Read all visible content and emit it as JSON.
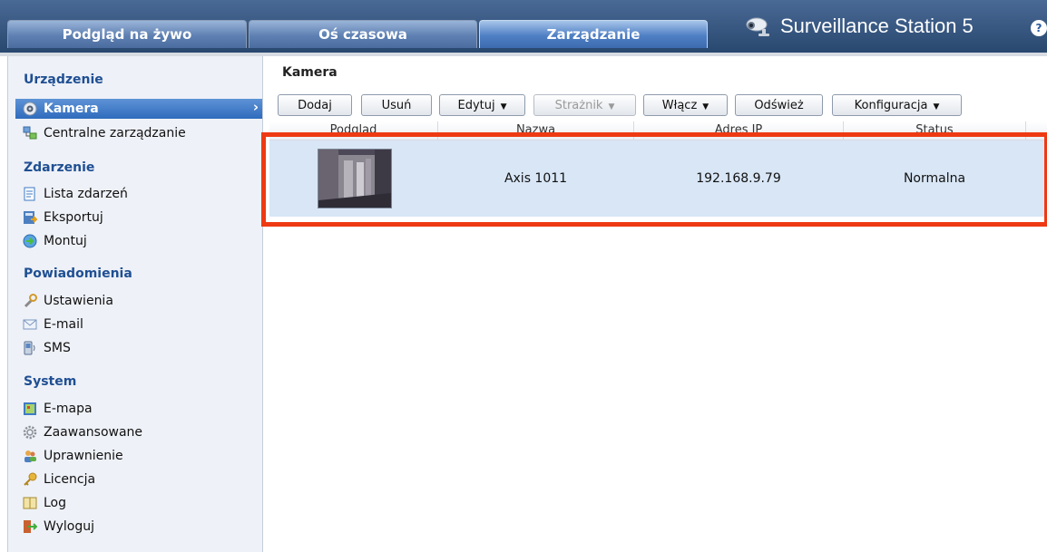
{
  "tabs": [
    {
      "label": "Podgląd na żywo"
    },
    {
      "label": "Oś czasowa"
    },
    {
      "label": "Zarządzanie"
    }
  ],
  "brand": {
    "title": "Surveillance Station 5"
  },
  "help_label": "?",
  "sidebar": {
    "sections": [
      {
        "title": "Urządzenie"
      },
      {
        "title": "Zdarzenie"
      },
      {
        "title": "Powiadomienia"
      },
      {
        "title": "System"
      }
    ],
    "items": [
      {
        "label": "Kamera",
        "icon": "camera-icon"
      },
      {
        "label": "Centralne zarządzanie",
        "icon": "central-management-icon"
      },
      {
        "label": "Lista zdarzeń",
        "icon": "event-list-icon"
      },
      {
        "label": "Eksportuj",
        "icon": "export-icon"
      },
      {
        "label": "Montuj",
        "icon": "mount-icon"
      },
      {
        "label": "Ustawienia",
        "icon": "wrench-icon"
      },
      {
        "label": "E-mail",
        "icon": "email-icon"
      },
      {
        "label": "SMS",
        "icon": "sms-icon"
      },
      {
        "label": "E-mapa",
        "icon": "emap-icon"
      },
      {
        "label": "Zaawansowane",
        "icon": "gear-icon"
      },
      {
        "label": "Uprawnienie",
        "icon": "users-icon"
      },
      {
        "label": "Licencja",
        "icon": "key-icon"
      },
      {
        "label": "Log",
        "icon": "book-icon"
      },
      {
        "label": "Wyloguj",
        "icon": "logout-icon"
      }
    ],
    "selected_chevron": "›"
  },
  "main": {
    "title": "Kamera",
    "toolbar": {
      "add": "Dodaj",
      "remove": "Usuń",
      "edit": "Edytuj",
      "guard": "Strażnik",
      "enable": "Włącz",
      "refresh": "Odśwież",
      "config": "Konfiguracja",
      "dropdown_glyph": "▼"
    },
    "table": {
      "headers": [
        "Podgląd",
        "Nazwa",
        "Adres IP",
        "Status"
      ],
      "rows": [
        {
          "name": "Axis 1011",
          "ip": "192.168.9.79",
          "status": "Normalna"
        }
      ]
    }
  },
  "colors": {
    "accent": "#2f6bbd",
    "section_title": "#1f4f93",
    "selected_row": "#d8e6f6",
    "highlight_box": "#ee3a13"
  }
}
